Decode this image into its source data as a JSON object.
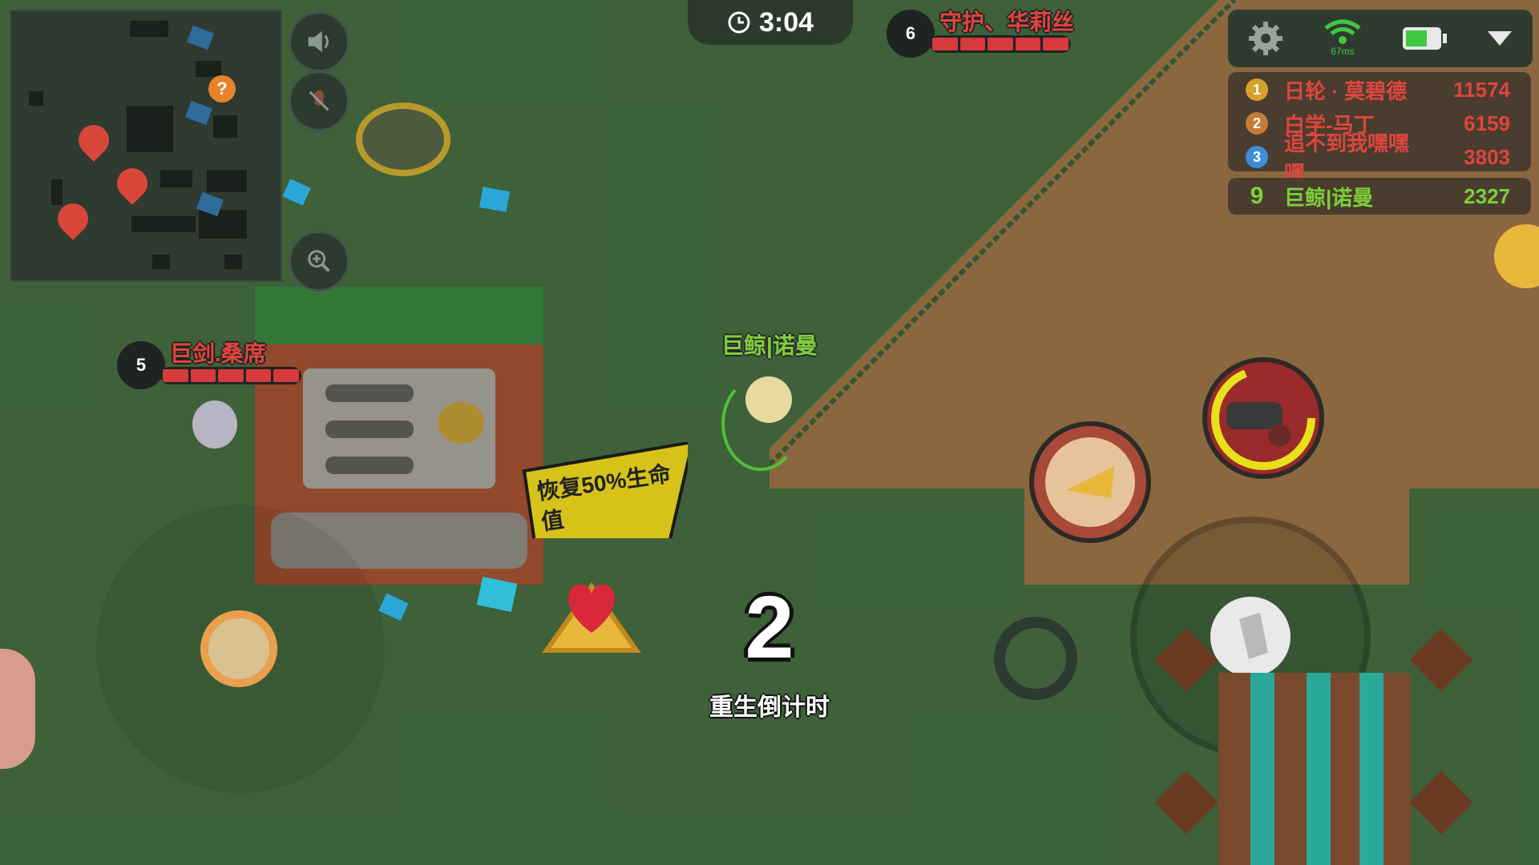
{
  "timer": {
    "icon": "clock-icon",
    "value": "3:04"
  },
  "top_enemy": {
    "level": "6",
    "name": "守护、华莉丝",
    "hp_segments": 5
  },
  "left_enemy": {
    "level": "5",
    "name": "巨剑.桑席",
    "hp_segments": 5
  },
  "player": {
    "name": "巨鲸|诺曼"
  },
  "status_bar": {
    "ping": "67ms",
    "icons": [
      "gear-icon",
      "wifi-icon",
      "battery-icon",
      "dropdown-icon"
    ]
  },
  "leaderboard": [
    {
      "rank": "1",
      "name": "日轮 · 莫碧德",
      "score": "11574"
    },
    {
      "rank": "2",
      "name": "白学-马丁",
      "score": "6159"
    },
    {
      "rank": "3",
      "name": "追不到我嘿嘿嘿",
      "score": "3803"
    }
  ],
  "my_rank": {
    "rank": "9",
    "name": "巨鲸|诺曼",
    "score": "2327"
  },
  "powerup_bubble": "恢复50%生命值",
  "respawn": {
    "count": "2",
    "label": "重生倒计时"
  },
  "colors": {
    "enemy": "#e0453d",
    "ally": "#7dcf3a",
    "dirt": "#b8844f",
    "grass": "#4e7c47"
  }
}
